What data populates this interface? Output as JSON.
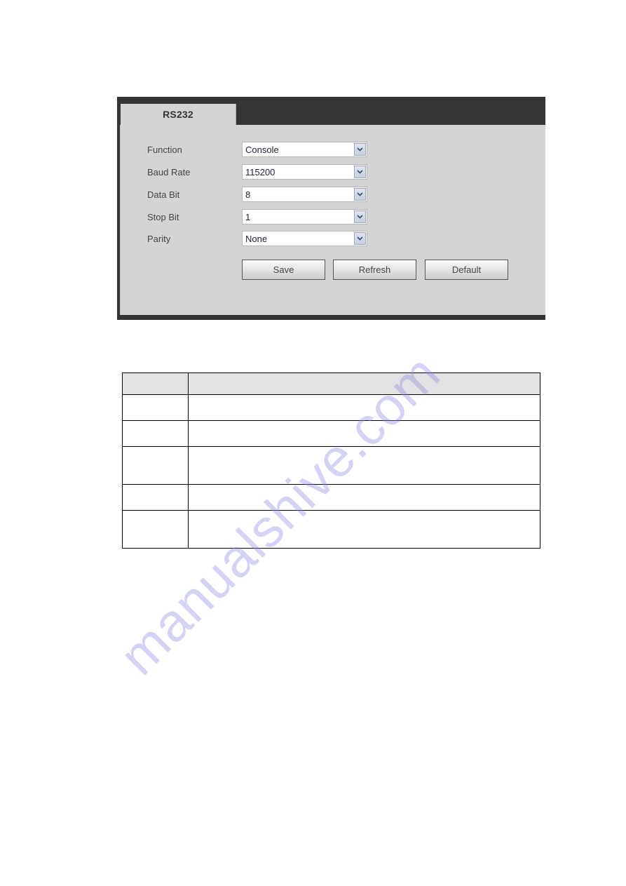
{
  "panel": {
    "tab_label": "RS232",
    "fields": [
      {
        "label": "Function",
        "value": "Console"
      },
      {
        "label": "Baud Rate",
        "value": "115200"
      },
      {
        "label": "Data Bit",
        "value": "8"
      },
      {
        "label": "Stop Bit",
        "value": "1"
      },
      {
        "label": "Parity",
        "value": "None"
      }
    ],
    "buttons": {
      "save": "Save",
      "refresh": "Refresh",
      "default": "Default"
    }
  },
  "table": {
    "header": [
      "",
      ""
    ],
    "rows": [
      [
        "",
        ""
      ],
      [
        "",
        ""
      ],
      [
        "",
        ""
      ],
      [
        "",
        ""
      ],
      [
        "",
        ""
      ]
    ]
  },
  "watermark": "manualshive.com",
  "colors": {
    "panel_frame": "#353535",
    "panel_body": "#d4d4d4",
    "table_header_bg": "#e2e2e2"
  }
}
